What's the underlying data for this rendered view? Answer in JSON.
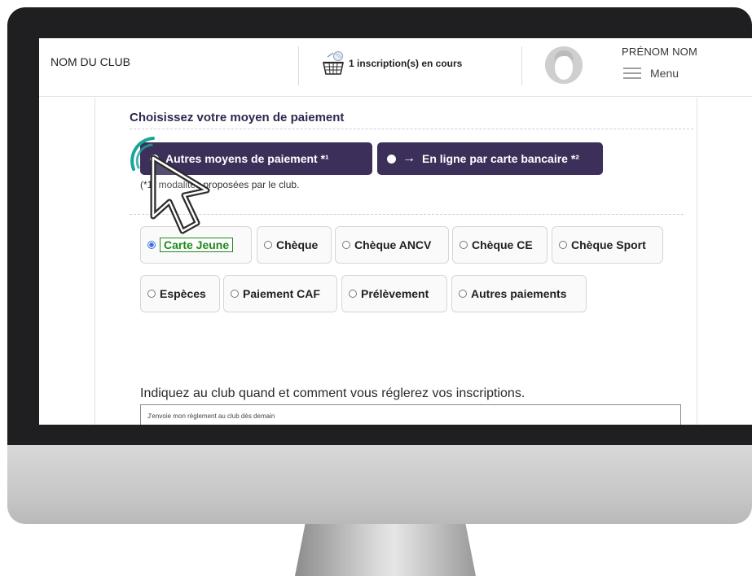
{
  "header": {
    "club_name": "NOM DU CLUB",
    "cart_text": "1 inscription(s) en cours",
    "user_name": "PRÉNOM NOM",
    "menu_label": "Menu"
  },
  "payment": {
    "title": "Choisissez votre moyen de paiement",
    "options": [
      {
        "label": "Autres moyens de paiement *¹",
        "selected": true
      },
      {
        "arrow": "→",
        "label": "En ligne par carte bancaire *²",
        "selected": false
      }
    ],
    "note": "(*1) modalités proposées par le club."
  },
  "methods": [
    {
      "label": "Carte Jeune",
      "selected": true
    },
    {
      "label": "Chèque",
      "selected": false
    },
    {
      "label": "Chèque ANCV",
      "selected": false
    },
    {
      "label": "Chèque CE",
      "selected": false
    },
    {
      "label": "Chèque Sport",
      "selected": false
    },
    {
      "label": "Espèces",
      "selected": false
    },
    {
      "label": "Paiement CAF",
      "selected": false
    },
    {
      "label": "Prélèvement",
      "selected": false
    },
    {
      "label": "Autres paiements",
      "selected": false
    }
  ],
  "instructions": {
    "label": "Indiquez au club quand et comment vous réglerez vos inscriptions.",
    "value": "J'envoie mon règlement au club dès demain"
  },
  "colors": {
    "primary": "#3c2f59",
    "selected_text": "#1b8a1b",
    "cursor_ring": "#1aa59a"
  },
  "icons": [
    "cart-icon",
    "avatar",
    "menu-icon",
    "cursor-arrow-icon"
  ]
}
